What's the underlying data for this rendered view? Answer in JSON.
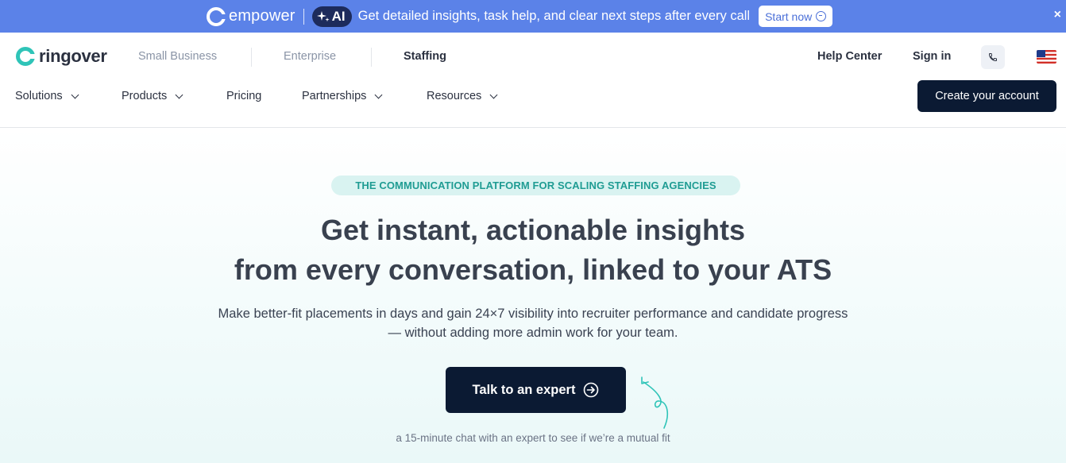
{
  "promo": {
    "brand": "empower",
    "badge": "AI",
    "message": "Get detailed insights, task help, and clear next steps after every call",
    "button_label": "Start now",
    "close_label": "×"
  },
  "header": {
    "logo_text": "ringover",
    "segments": [
      "Small Business",
      "Enterprise",
      "Staffing"
    ],
    "active_segment": "Staffing",
    "help_center": "Help Center",
    "sign_in": "Sign in",
    "nav": {
      "solutions": "Solutions",
      "products": "Products",
      "pricing": "Pricing",
      "partnerships": "Partnerships",
      "resources": "Resources"
    },
    "create_account": "Create your account"
  },
  "hero": {
    "eyebrow": "THE COMMUNICATION PLATFORM FOR SCALING STAFFING AGENCIES",
    "headline_line1": "Get instant, actionable insights",
    "headline_line2": "from every conversation, linked to your ATS",
    "subtext_line1": "Make better-fit placements in days and gain 24×7 visibility into recruiter performance and candidate progress",
    "subtext_line2": "— without adding more admin work for your team.",
    "cta_label": "Talk to an expert",
    "note": "a 15-minute chat with an expert to see if we’re a mutual fit"
  },
  "colors": {
    "promo_bg": "#5b82e8",
    "primary_dark": "#0b1a33",
    "accent_teal": "#1f9c93",
    "eyebrow_bg": "#d9f3f1"
  },
  "icons": [
    "empower-logo-icon",
    "sparkle-icon",
    "arrow-circle-icon",
    "close-icon",
    "ringover-logo-icon",
    "phone-icon",
    "us-flag-icon",
    "chevron-down-icon",
    "squiggle-arrow-icon"
  ]
}
